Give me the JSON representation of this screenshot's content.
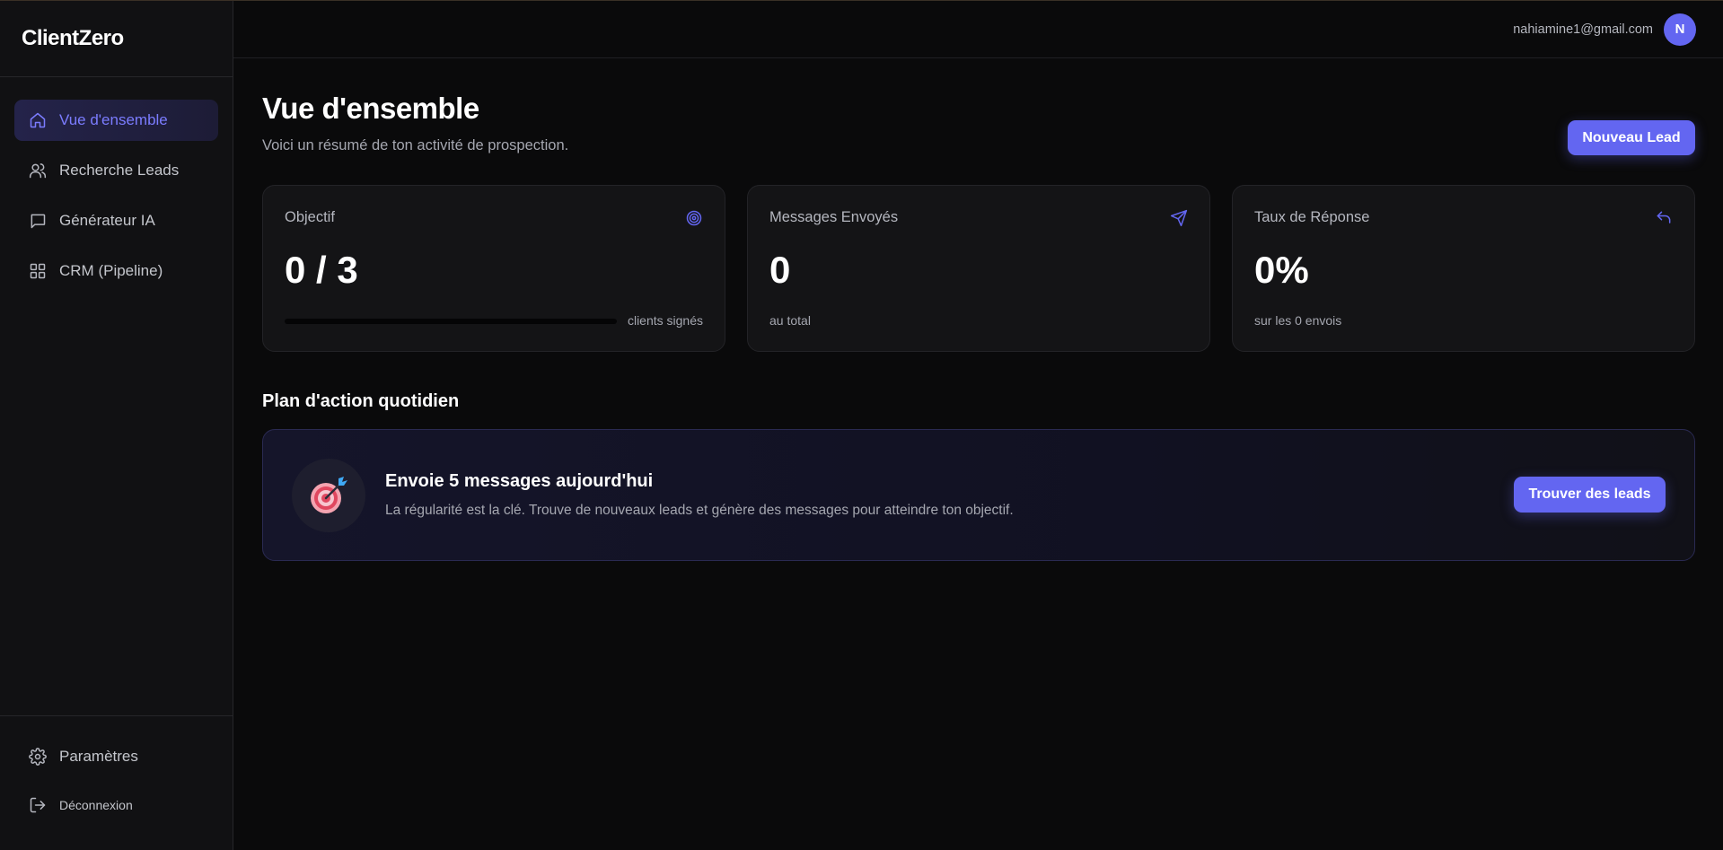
{
  "brand": "ClientZero",
  "sidebar": {
    "items": [
      {
        "label": "Vue d'ensemble",
        "icon": "home-icon",
        "active": true
      },
      {
        "label": "Recherche Leads",
        "icon": "users-icon"
      },
      {
        "label": "Générateur IA",
        "icon": "message-icon"
      },
      {
        "label": "CRM (Pipeline)",
        "icon": "grid-icon"
      }
    ],
    "settings_label": "Paramètres",
    "logout_label": "Déconnexion"
  },
  "topbar": {
    "email": "nahiamine1@gmail.com",
    "avatar_initial": "N"
  },
  "header": {
    "title": "Vue d'ensemble",
    "subtitle": "Voici un résumé de ton activité de prospection.",
    "new_lead_label": "Nouveau Lead"
  },
  "stats": {
    "objective": {
      "label": "Objectif",
      "value": "0 / 3",
      "foot": "clients signés",
      "progress": 0
    },
    "messages": {
      "label": "Messages Envoyés",
      "value": "0",
      "foot": "au total"
    },
    "response": {
      "label": "Taux de Réponse",
      "value": "0%",
      "foot": "sur les 0 envois"
    }
  },
  "plan": {
    "section_title": "Plan d'action quotidien",
    "title": "Envoie 5 messages aujourd'hui",
    "description": "La régularité est la clé. Trouve de nouveaux leads et génère des messages pour atteindre ton objectif.",
    "button_label": "Trouver des leads"
  },
  "colors": {
    "accent": "#6366f1",
    "background": "#0a0a0b",
    "sidebar": "#111113",
    "card": "#141416"
  }
}
